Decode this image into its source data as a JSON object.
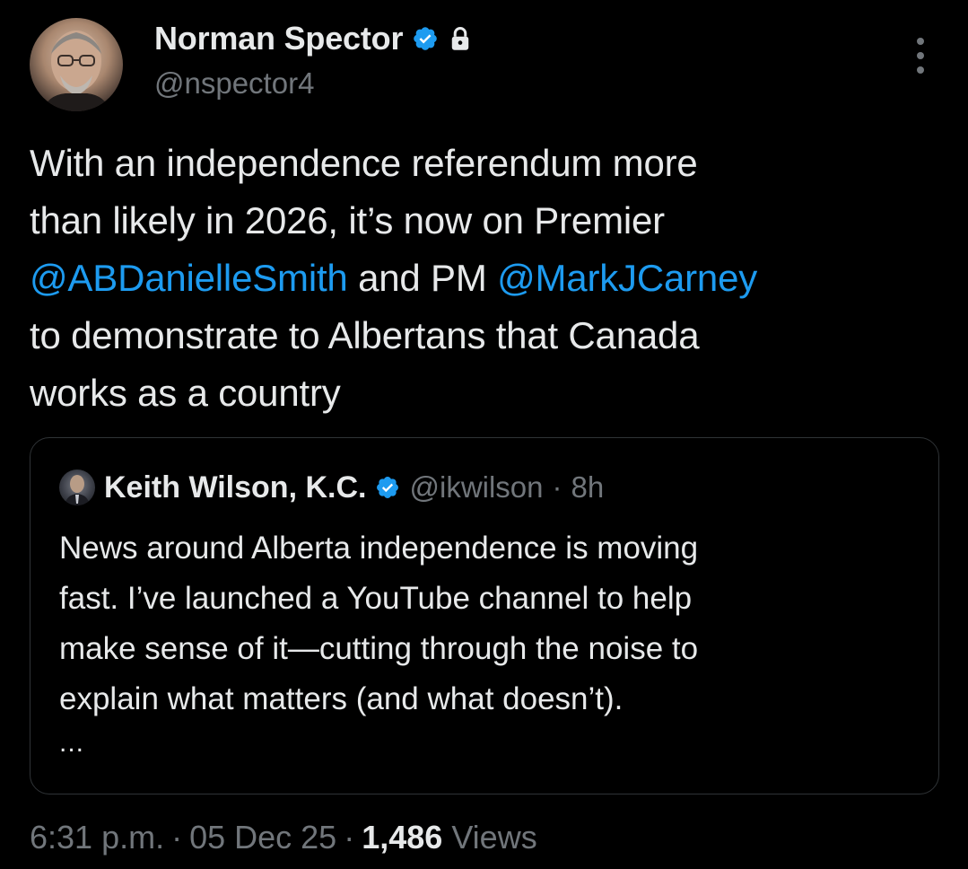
{
  "author": {
    "display_name": "Norman Spector",
    "handle": "@nspector4",
    "verified": true,
    "protected": true
  },
  "tweet": {
    "lines": [
      [
        {
          "text": "With an independence referendum more",
          "type": "text"
        }
      ],
      [
        {
          "text": "than likely in 2026, it’s now on Premier",
          "type": "text"
        }
      ],
      [
        {
          "text": "@ABDanielleSmith",
          "type": "mention"
        },
        {
          "text": " and PM ",
          "type": "text"
        },
        {
          "text": "@MarkJCarney",
          "type": "mention"
        }
      ],
      [
        {
          "text": "to demonstrate to Albertans that Canada",
          "type": "text"
        }
      ],
      [
        {
          "text": "works as a country",
          "type": "text"
        }
      ]
    ]
  },
  "quote": {
    "display_name": "Keith Wilson, K.C.",
    "verified": true,
    "handle": "@ikwilson",
    "separator": "·",
    "time": "8h",
    "lines": [
      "News around Alberta independence is moving",
      "fast. I’ve launched a YouTube channel to help",
      "make sense of it—cutting through the noise to",
      "explain what matters (and what doesn’t)."
    ],
    "ellipsis": "..."
  },
  "meta": {
    "time": "6:31 p.m.",
    "sep1": "·",
    "date": "05 Dec 25",
    "sep2": "·",
    "views_count": "1,486",
    "views_label": "Views"
  },
  "icons": {
    "verified": "verified-badge-icon",
    "lock": "lock-icon",
    "more": "more-options-icon"
  },
  "colors": {
    "background": "#000000",
    "text": "#e7e9ea",
    "muted": "#71767b",
    "link": "#1d9bf0",
    "verified": "#1d9bf0",
    "border": "#2f3336"
  }
}
